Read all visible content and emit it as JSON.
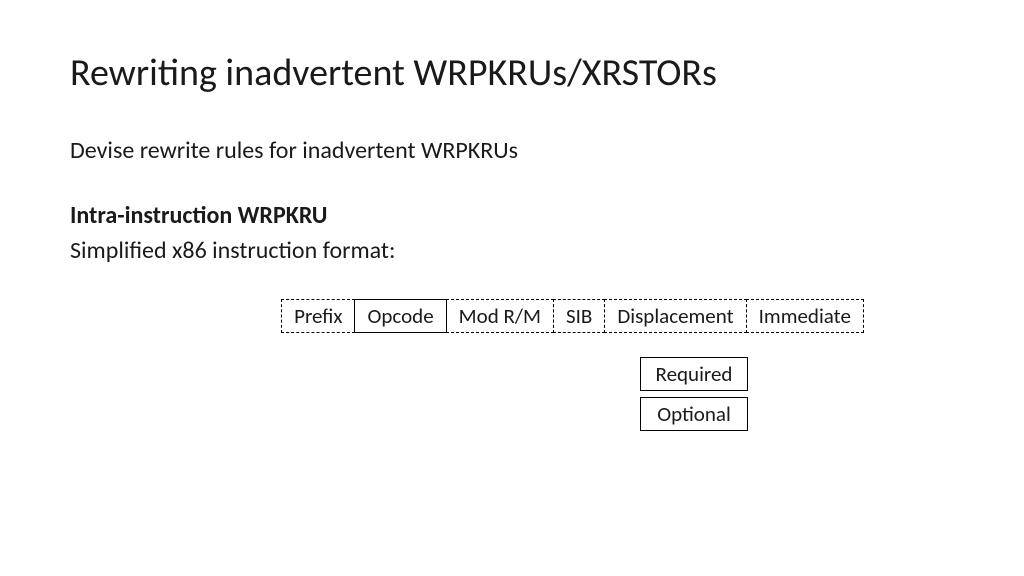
{
  "title": "Rewriting inadvertent WRPKRUs/XRSTORs",
  "intro": "Devise rewrite rules for inadvertent WRPKRUs",
  "section_heading": "Intra-instruction WRPKRU",
  "sub_text": "Simplified x86 instruction format:",
  "fields": {
    "prefix": "Prefix",
    "opcode": "Opcode",
    "modrm": "Mod R/M",
    "sib": "SIB",
    "displacement": "Displacement",
    "immediate": "Immediate"
  },
  "legend": {
    "required": "Required",
    "optional": "Optional"
  }
}
